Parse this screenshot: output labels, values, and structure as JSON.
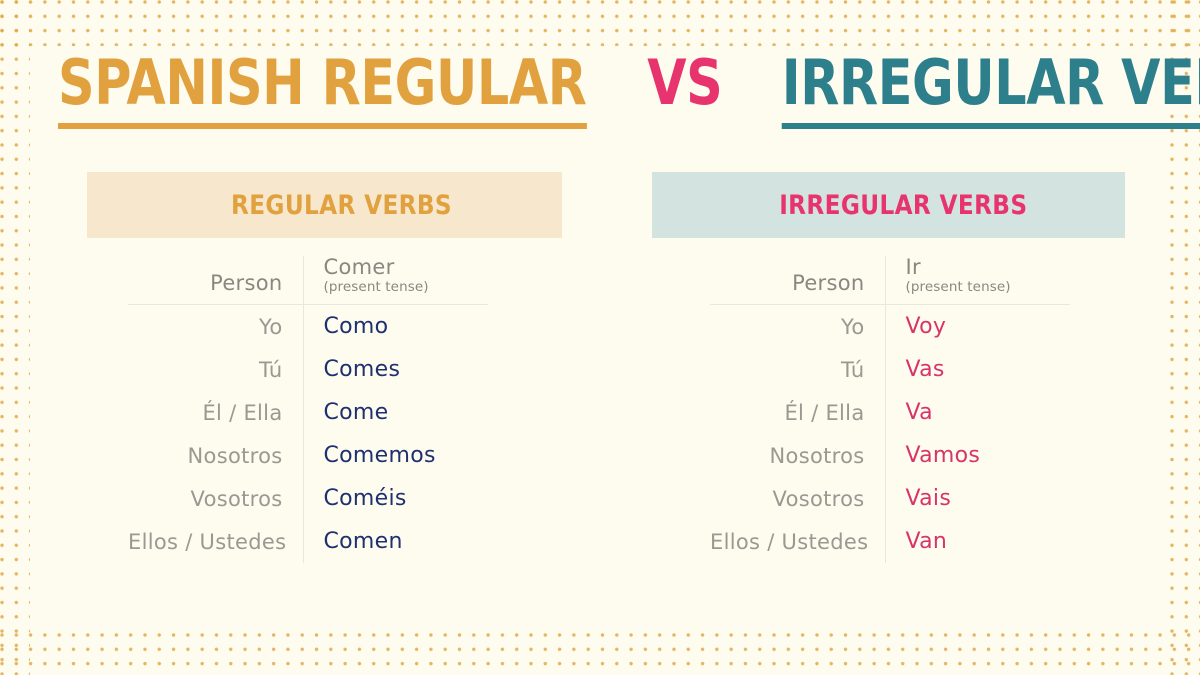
{
  "theme": {
    "background": "#fdfcef",
    "dot_color": "#e0a94a",
    "orange": "#e2a13f",
    "pink": "#e8346e",
    "teal": "#2d7f8c",
    "band_left_bg": "#f7e8cd",
    "band_right_bg": "#d3e3df",
    "regular_verb_text": "#1f3070",
    "irregular_verb_text": "#d8336a",
    "person_text": "#9b9892",
    "rule_color": "#e9e7dc"
  },
  "title": {
    "part1": "SPANISH REGULAR",
    "part2": "VS",
    "part3": "IRREGULAR VERBS"
  },
  "left": {
    "band_label": "REGULAR VERBS",
    "headers": {
      "person": "Person",
      "verb": "Comer",
      "tense": "(present tense)"
    },
    "rows": [
      {
        "person": "Yo",
        "verb": "Como"
      },
      {
        "person": "Tú",
        "verb": "Comes"
      },
      {
        "person": "Él / Ella",
        "verb": "Come"
      },
      {
        "person": "Nosotros",
        "verb": "Comemos"
      },
      {
        "person": "Vosotros",
        "verb": "Coméis"
      },
      {
        "person": "Ellos / Ustedes",
        "verb": "Comen"
      }
    ]
  },
  "right": {
    "band_label": "IRREGULAR VERBS",
    "headers": {
      "person": "Person",
      "verb": "Ir",
      "tense": "(present tense)"
    },
    "rows": [
      {
        "person": "Yo",
        "verb": "Voy"
      },
      {
        "person": "Tú",
        "verb": "Vas"
      },
      {
        "person": "Él / Ella",
        "verb": "Va"
      },
      {
        "person": "Nosotros",
        "verb": "Vamos"
      },
      {
        "person": "Vosotros",
        "verb": "Vais"
      },
      {
        "person": "Ellos / Ustedes",
        "verb": "Van"
      }
    ]
  }
}
